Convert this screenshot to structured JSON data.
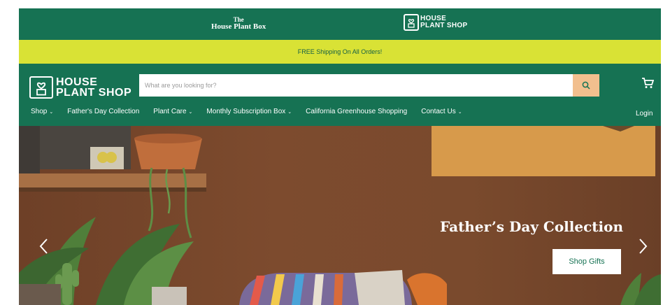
{
  "brandbar": {
    "plantbox_line1": "The",
    "plantbox_line2": "House Plant Box",
    "shop_line1": "HOUSE",
    "shop_line2": "PLANT SHOP"
  },
  "announcement": {
    "text": "FREE Shipping On All Orders!"
  },
  "header": {
    "logo_line1": "HOUSE",
    "logo_line2": "PLANT SHOP",
    "search_placeholder": "What are you looking for?"
  },
  "nav": {
    "items": [
      {
        "label": "Shop",
        "dropdown": true
      },
      {
        "label": "Father's Day Collection",
        "dropdown": false
      },
      {
        "label": "Plant Care",
        "dropdown": true
      },
      {
        "label": "Monthly Subscription Box",
        "dropdown": true
      },
      {
        "label": "California Greenhouse Shopping",
        "dropdown": false
      },
      {
        "label": "Contact Us",
        "dropdown": true
      }
    ],
    "login": "Login",
    "caret_glyph": "⌄"
  },
  "hero": {
    "title": "Father’s Day Collection",
    "button": "Shop Gifts"
  },
  "colors": {
    "brand_green": "#167253",
    "announce_yellow": "#d9e235",
    "search_button": "#f2bf8e"
  },
  "icons": [
    "house-plant-logo-icon",
    "search-icon",
    "cart-icon",
    "chevron-left-icon",
    "chevron-right-icon"
  ]
}
